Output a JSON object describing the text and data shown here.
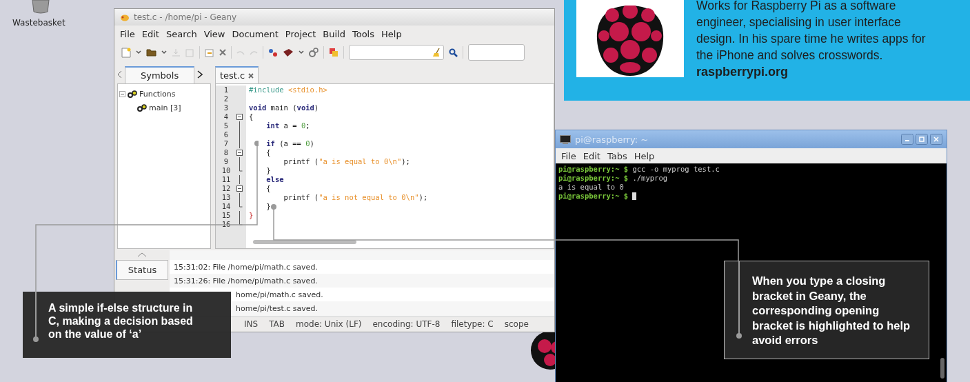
{
  "desktop": {
    "icon_label": "Wastebasket"
  },
  "geany": {
    "title": "test.c - /home/pi - Geany",
    "menu": [
      "File",
      "Edit",
      "Search",
      "View",
      "Document",
      "Project",
      "Build",
      "Tools",
      "Help"
    ],
    "sidebar_tabs": [
      {
        "label": "Symbols",
        "selected": true
      }
    ],
    "symbols": [
      {
        "label": "Functions",
        "expanded": true,
        "children": [
          {
            "label": "main [3]"
          }
        ]
      }
    ],
    "editor_tabs": [
      {
        "label": "test.c",
        "selected": true
      }
    ],
    "code": [
      {
        "number": "1",
        "fold_start": false,
        "fold_end": false,
        "tokens": [
          {
            "kind": "preproc",
            "text": "#include"
          },
          {
            "kind": "string",
            "text": " <stdio.h>"
          }
        ]
      },
      {
        "number": "2",
        "fold_start": false,
        "fold_end": false
      },
      {
        "number": "3",
        "fold_start": false,
        "fold_end": false,
        "tokens": [
          {
            "kind": "keyword",
            "text": "void"
          },
          {
            "kind": "plain",
            "text": " main ("
          },
          {
            "kind": "keyword",
            "text": "void"
          },
          {
            "kind": "plain",
            "text": ")"
          }
        ]
      },
      {
        "number": "4",
        "fold_start": true,
        "fold_end": false,
        "tokens": [
          {
            "kind": "plain",
            "text": "{"
          }
        ]
      },
      {
        "number": "5",
        "fold_start": false,
        "fold_end": false,
        "tokens": [
          {
            "kind": "keyword",
            "text": "    int"
          },
          {
            "kind": "plain",
            "text": " a = "
          },
          {
            "kind": "number",
            "text": "0"
          },
          {
            "kind": "plain",
            "text": ";"
          }
        ]
      },
      {
        "number": "6",
        "fold_start": false,
        "fold_end": false
      },
      {
        "number": "7",
        "fold_start": false,
        "fold_end": false,
        "tokens": [
          {
            "kind": "keyword",
            "text": "    if"
          },
          {
            "kind": "plain",
            "text": " (a == "
          },
          {
            "kind": "number",
            "text": "0"
          },
          {
            "kind": "plain",
            "text": ")"
          }
        ]
      },
      {
        "number": "8",
        "fold_start": true,
        "fold_end": false,
        "tokens": [
          {
            "kind": "plain",
            "text": "    {"
          }
        ]
      },
      {
        "number": "9",
        "fold_start": false,
        "fold_end": false,
        "tokens": [
          {
            "kind": "plain",
            "text": "        printf ("
          },
          {
            "kind": "string",
            "text": "\"a is equal to 0\\n\""
          },
          {
            "kind": "plain",
            "text": ");"
          }
        ]
      },
      {
        "number": "10",
        "fold_start": false,
        "fold_end": true,
        "tokens": [
          {
            "kind": "plain",
            "text": "    }"
          }
        ]
      },
      {
        "number": "11",
        "fold_start": false,
        "fold_end": false,
        "tokens": [
          {
            "kind": "keyword",
            "text": "    else"
          }
        ]
      },
      {
        "number": "12",
        "fold_start": true,
        "fold_end": false,
        "tokens": [
          {
            "kind": "plain",
            "text": "    {"
          }
        ]
      },
      {
        "number": "13",
        "fold_start": false,
        "fold_end": false,
        "tokens": [
          {
            "kind": "plain",
            "text": "        printf ("
          },
          {
            "kind": "string",
            "text": "\"a is not equal to 0\\n\""
          },
          {
            "kind": "plain",
            "text": ");"
          }
        ]
      },
      {
        "number": "14",
        "fold_start": false,
        "fold_end": true,
        "tokens": [
          {
            "kind": "plain",
            "text": "    }"
          }
        ]
      },
      {
        "number": "15",
        "fold_start": false,
        "fold_end": false,
        "tokens": [
          {
            "kind": "brace",
            "text": "}"
          }
        ]
      },
      {
        "number": "16",
        "fold_start": false,
        "fold_end": true
      }
    ],
    "message_tabs": [
      {
        "label": "Status",
        "selected": true
      }
    ],
    "messages": [
      {
        "kind": "full",
        "text": "15:31:02: File /home/pi/math.c saved."
      },
      {
        "kind": "full",
        "text": "15:31:26: File /home/pi/math.c saved."
      },
      {
        "kind": "partial",
        "text": "home/pi/math.c saved."
      },
      {
        "kind": "partial",
        "text": "home/pi/test.c saved."
      }
    ],
    "status_bar": [
      "INS",
      "TAB",
      "mode: Unix (LF)",
      "encoding: UTF-8",
      "filetype: C",
      "scope"
    ]
  },
  "terminal": {
    "title": "pi@raspberry: ~",
    "menu": [
      "File",
      "Edit",
      "Tabs",
      "Help"
    ],
    "lines": [
      {
        "prompt": "pi@raspberry:~ $",
        "text": " gcc -o myprog test.c",
        "cursor": false
      },
      {
        "prompt": "pi@raspberry:~ $",
        "text": " ./myprog",
        "cursor": false
      },
      {
        "text": "a is equal to 0",
        "cursor": false
      },
      {
        "prompt": "pi@raspberry:~ $",
        "cursor": true
      }
    ]
  },
  "bio": {
    "text": "Works for Raspberry Pi as a software engineer, specialising in user interface design. In his spare time he writes apps for the iPhone and solves crosswords.",
    "link": "raspberrypi.org"
  },
  "callouts": [
    {
      "text": "A simple if-else structure in C, making a decision based on the value of ‘a’"
    },
    {
      "text": "When you type a closing bracket in Geany, the corresponding opening bracket is highlighted to help avoid errors"
    }
  ]
}
